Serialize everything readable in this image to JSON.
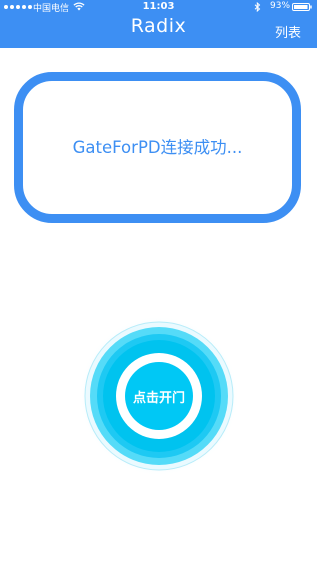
{
  "status_bar": {
    "carrier": "中国电信",
    "time": "11:03",
    "battery": "93%",
    "icons": [
      "signal-dots-icon",
      "wifi-icon",
      "bluetooth-icon",
      "battery-icon"
    ]
  },
  "nav": {
    "title": "Radix",
    "list_button": "列表"
  },
  "connection": {
    "status_text": "GateForPD连接成功..."
  },
  "door_button": {
    "label": "点击开门"
  },
  "colors": {
    "brand_blue": "#3d8ff3",
    "button_cyan": "#00c8f5",
    "background": "#ffffff"
  }
}
